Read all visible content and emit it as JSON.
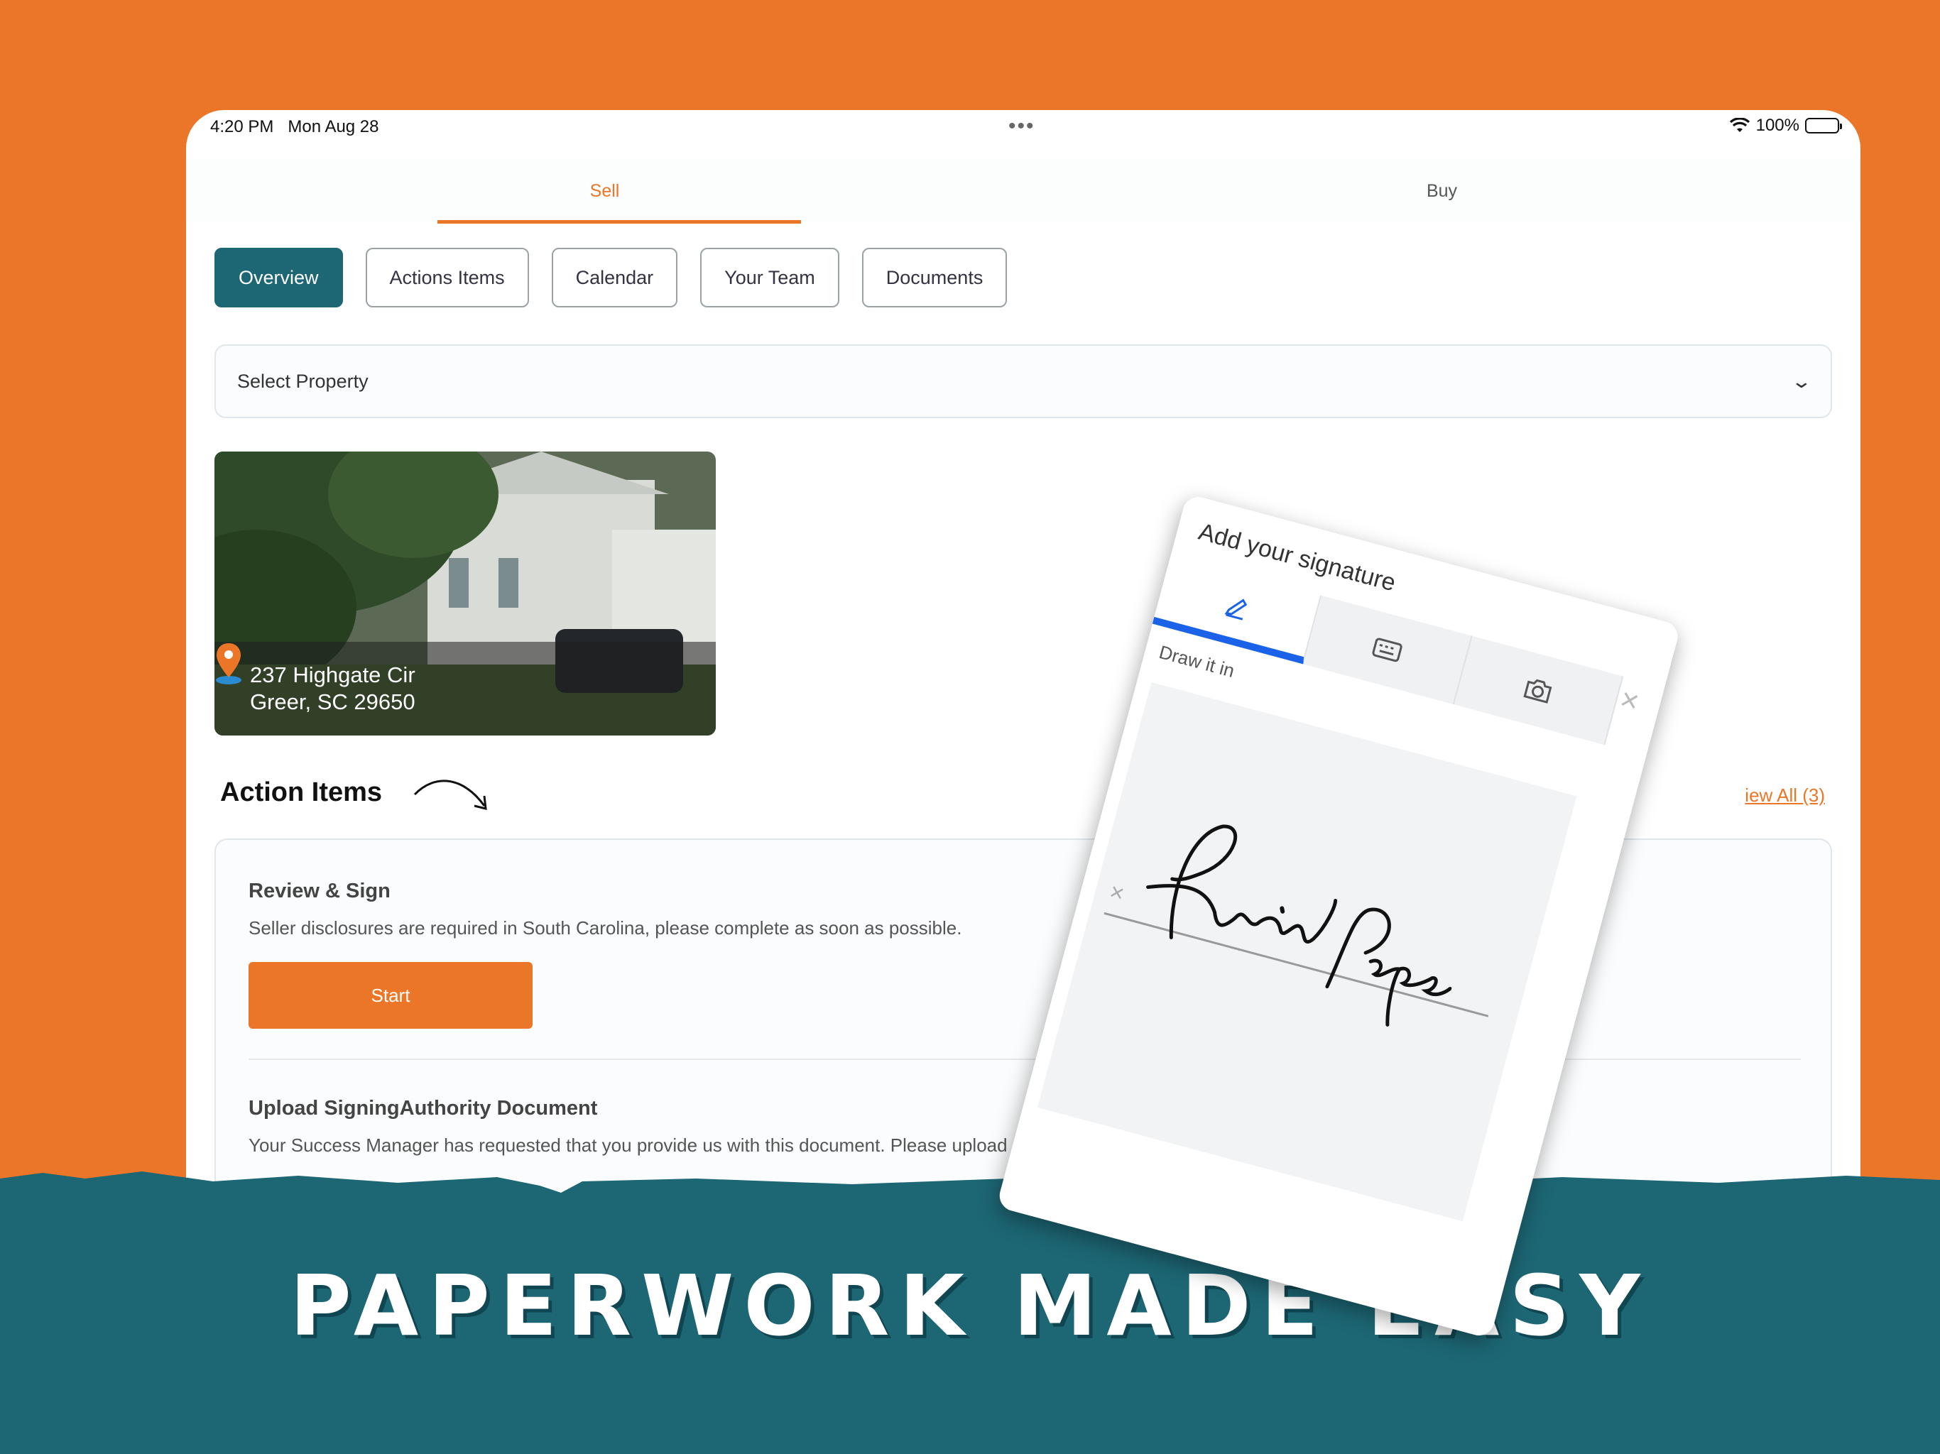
{
  "status_bar": {
    "time": "4:20 PM",
    "date": "Mon Aug 28",
    "dots": "•••",
    "battery_percent": "100%",
    "battery_level": 1.0
  },
  "top_tabs": [
    {
      "label": "Sell",
      "active": true
    },
    {
      "label": "Buy",
      "active": false
    }
  ],
  "nav_pills": [
    {
      "label": "Overview",
      "active": true
    },
    {
      "label": "Actions Items",
      "active": false
    },
    {
      "label": "Calendar",
      "active": false
    },
    {
      "label": "Your Team",
      "active": false
    },
    {
      "label": "Documents",
      "active": false
    }
  ],
  "property_select": {
    "label": "Select Property",
    "icon": "chevron-down-icon"
  },
  "property_card": {
    "address_line1": "237 Highgate Cir",
    "address_line2": "Greer, SC 29650",
    "icon": "location-pin-icon"
  },
  "action_items": {
    "heading": "Action Items",
    "view_all": "iew All (3)",
    "items": [
      {
        "title": "Review & Sign",
        "description": "Seller disclosures are required in South Carolina, please complete as soon as possible.",
        "button": "Start"
      },
      {
        "title": "Upload SigningAuthority Document",
        "description": "Your Success Manager has requested that you provide us with this document. Please upload as soo"
      }
    ]
  },
  "signature_dialog": {
    "title": "Add your signature",
    "tabs": [
      {
        "icon": "pen-icon",
        "active": true
      },
      {
        "icon": "keyboard-icon",
        "active": false
      },
      {
        "icon": "camera-icon",
        "active": false
      }
    ],
    "hint": "Draw it in",
    "clear_symbol": "×",
    "close_symbol": "×"
  },
  "banner": {
    "text": "PAPERWORK MADE EASY"
  },
  "colors": {
    "brand_orange": "#ec7628",
    "brand_teal": "#1d6674",
    "signature_blue": "#1a63e8"
  }
}
